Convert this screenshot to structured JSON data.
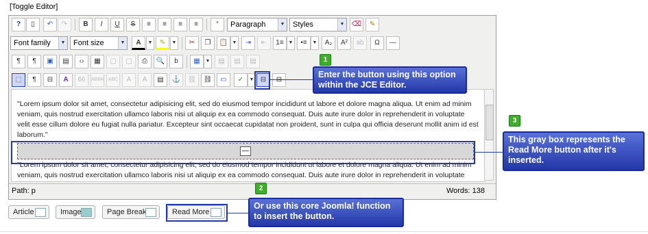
{
  "toggle_label": "[Toggle Editor]",
  "toolbar": {
    "paragraph_value": "Paragraph",
    "styles_value": "Styles",
    "font_family_value": "Font family",
    "font_size_value": "Font size"
  },
  "content": {
    "para1": "\"Lorem ipsum dolor sit amet, consectetur adipisicing elit, sed do eiusmod tempor incididunt ut labore et dolore magna aliqua. Ut enim ad minim veniam, quis nostrud exercitation ullamco laboris nisi ut aliquip ex ea commodo consequat. Duis aute irure dolor in reprehenderit in voluptate velit esse cillum dolore eu fugiat nulla pariatur. Excepteur sint occaecat cupidatat non proident, sunt in culpa qui officia deserunt mollit anim id est laborum.\"",
    "para2": "\"Lorem ipsum dolor sit amet, consectetur adipisicing elit, sed do eiusmod tempor incididunt ut labore et dolore magna aliqua. Ut enim ad minim veniam, quis nostrud exercitation ullamco laboris nisi ut aliquip ex ea commodo consequat. Duis aute irure dolor in reprehenderit in voluptate velit esse cillum dolore eu fugiat nulla pariatur. Excepteur sint occaecat cupidatat non proident, sunt in culpa qui officia deserunt"
  },
  "status": {
    "path": "Path:  p",
    "words": "Words: 138"
  },
  "buttons": {
    "article": "Article",
    "image": "Image",
    "page_break": "Page Break",
    "read_more": "Read More"
  },
  "callouts": {
    "c1_num": "1",
    "c1_text": "Enter the button using this option within the JCE Editor.",
    "c2_num": "2",
    "c2_text": "Or use this core Joomla! function to insert the button.",
    "c3_num": "3",
    "c3_text": "This gray box represents the Read More button after it's inserted."
  },
  "colors": {
    "callout": "#2438a8",
    "badge": "#3fae2b"
  }
}
